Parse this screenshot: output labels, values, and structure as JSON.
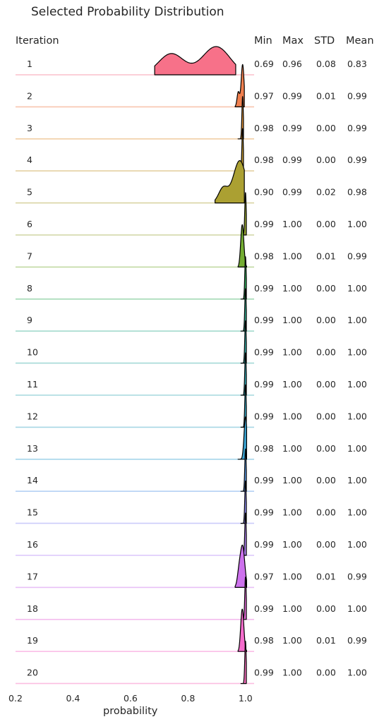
{
  "chart_data": {
    "type": "ridgeline",
    "title": "Selected Probability Distribution",
    "xlabel": "probability",
    "row_header": "Iteration",
    "stat_headers": [
      "Min",
      "Max",
      "STD",
      "Mean"
    ],
    "xlim": [
      0.2,
      1.03
    ],
    "xticks": [
      "0.2",
      "0.4",
      "0.6",
      "0.8",
      "1.0"
    ],
    "xtick_values": [
      0.2,
      0.4,
      0.6,
      0.8,
      1.0
    ],
    "colors": [
      "#f77189",
      "#f07f4e",
      "#e0943a",
      "#c59a32",
      "#aba032",
      "#96a432",
      "#74ad32",
      "#35ae5e",
      "#35ad91",
      "#36aba6",
      "#37a9b5",
      "#39a7c4",
      "#3aa4d3",
      "#5a9ae6",
      "#8f8ef4",
      "#b081f4",
      "#cd71ed",
      "#e56ad9",
      "#f56ccc",
      "#f66ebd"
    ],
    "series": [
      {
        "iteration": "1",
        "min": "0.69",
        "max": "0.96",
        "std": "0.08",
        "mean": "0.83"
      },
      {
        "iteration": "2",
        "min": "0.97",
        "max": "0.99",
        "std": "0.01",
        "mean": "0.99"
      },
      {
        "iteration": "3",
        "min": "0.98",
        "max": "0.99",
        "std": "0.00",
        "mean": "0.99"
      },
      {
        "iteration": "4",
        "min": "0.98",
        "max": "0.99",
        "std": "0.00",
        "mean": "0.99"
      },
      {
        "iteration": "5",
        "min": "0.90",
        "max": "0.99",
        "std": "0.02",
        "mean": "0.98"
      },
      {
        "iteration": "6",
        "min": "0.99",
        "max": "1.00",
        "std": "0.00",
        "mean": "1.00"
      },
      {
        "iteration": "7",
        "min": "0.98",
        "max": "1.00",
        "std": "0.01",
        "mean": "0.99"
      },
      {
        "iteration": "8",
        "min": "0.99",
        "max": "1.00",
        "std": "0.00",
        "mean": "1.00"
      },
      {
        "iteration": "9",
        "min": "0.99",
        "max": "1.00",
        "std": "0.00",
        "mean": "1.00"
      },
      {
        "iteration": "10",
        "min": "0.99",
        "max": "1.00",
        "std": "0.00",
        "mean": "1.00"
      },
      {
        "iteration": "11",
        "min": "0.99",
        "max": "1.00",
        "std": "0.00",
        "mean": "1.00"
      },
      {
        "iteration": "12",
        "min": "0.99",
        "max": "1.00",
        "std": "0.00",
        "mean": "1.00"
      },
      {
        "iteration": "13",
        "min": "0.98",
        "max": "1.00",
        "std": "0.00",
        "mean": "1.00"
      },
      {
        "iteration": "14",
        "min": "0.99",
        "max": "1.00",
        "std": "0.00",
        "mean": "1.00"
      },
      {
        "iteration": "15",
        "min": "0.99",
        "max": "1.00",
        "std": "0.00",
        "mean": "1.00"
      },
      {
        "iteration": "16",
        "min": "0.99",
        "max": "1.00",
        "std": "0.00",
        "mean": "1.00"
      },
      {
        "iteration": "17",
        "min": "0.97",
        "max": "1.00",
        "std": "0.01",
        "mean": "0.99"
      },
      {
        "iteration": "18",
        "min": "0.99",
        "max": "1.00",
        "std": "0.00",
        "mean": "1.00"
      },
      {
        "iteration": "19",
        "min": "0.98",
        "max": "1.00",
        "std": "0.01",
        "mean": "0.99"
      },
      {
        "iteration": "20",
        "min": "0.99",
        "max": "1.00",
        "std": "0.00",
        "mean": "1.00"
      }
    ]
  }
}
